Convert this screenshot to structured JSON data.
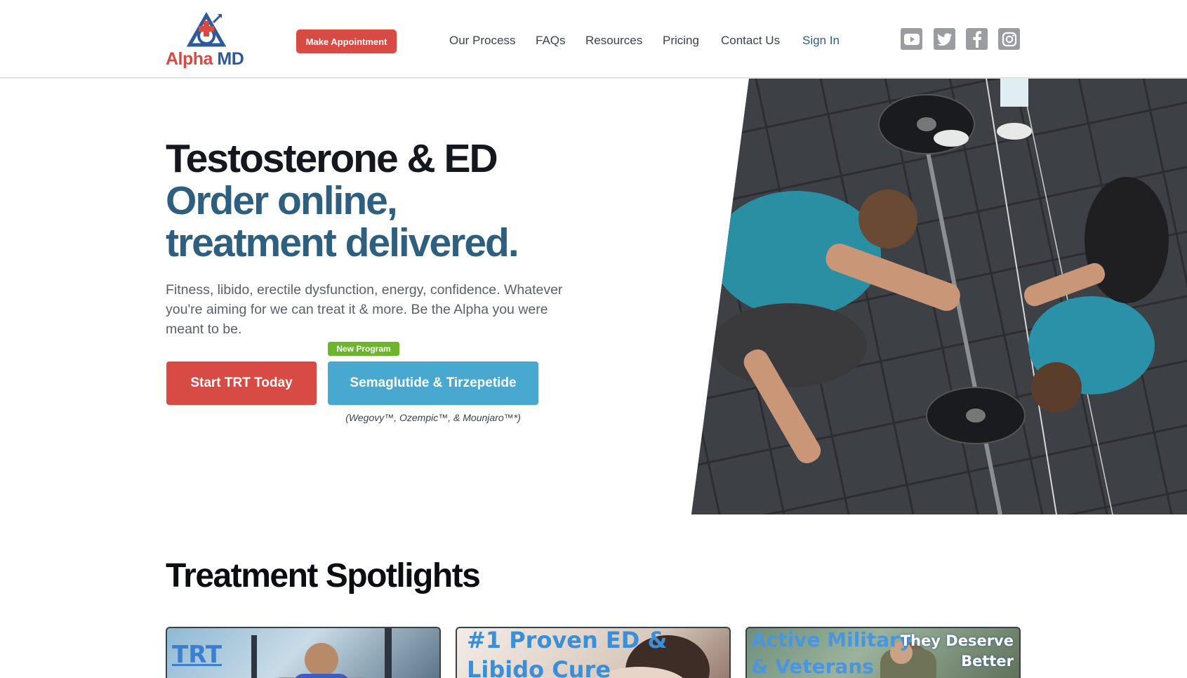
{
  "brand": {
    "logo_part1": "Alpha",
    "logo_part2": "MD"
  },
  "header": {
    "appointment_label": "Make Appointment",
    "nav": [
      {
        "label": "Our Process"
      },
      {
        "label": "FAQs"
      },
      {
        "label": "Resources"
      },
      {
        "label": "Pricing"
      },
      {
        "label": "Contact Us"
      },
      {
        "label": "Sign In"
      }
    ],
    "social": [
      "youtube-icon",
      "twitter-icon",
      "facebook-icon",
      "instagram-icon"
    ]
  },
  "hero": {
    "title_line1": "Testosterone & ED",
    "title_line2": "Order online,",
    "title_line3": "treatment delivered.",
    "description": "Fitness, libido, erectile dysfunction, energy, confidence. Whatever you're aiming for we can treat it & more. Be the Alpha you were meant to be.",
    "cta_primary": "Start TRT Today",
    "badge": "New Program",
    "cta_secondary": "Semaglutide & Tirzepetide",
    "cta_secondary_note": "(Wegovy™, Ozempic™, & Mounjaro™*)"
  },
  "spotlights": {
    "title": "Treatment Spotlights",
    "cards": [
      {
        "text": "TRT"
      },
      {
        "text_line1": "#1 Proven ED &",
        "text_line2": "Libido Cure"
      },
      {
        "text_line1": "Active Military",
        "text_line2": "& Veterans",
        "side_line1": "They Deserve",
        "side_line2": "Better"
      }
    ]
  },
  "colors": {
    "accent_red": "#d84a44",
    "accent_blue": "#48a8cf",
    "heading_blue": "#2e5f7f",
    "badge_green": "#6cb52d"
  }
}
